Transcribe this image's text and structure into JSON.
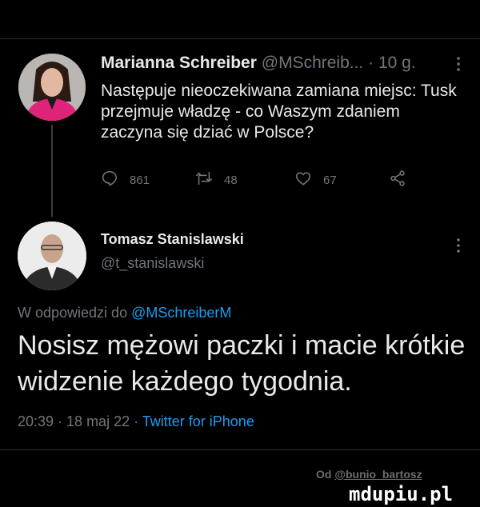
{
  "tweet1": {
    "name": "Marianna Schreiber",
    "handle": "@MSchreib...",
    "time": "· 10 g.",
    "text": "Następuje nieoczekiwana zamiana miejsc: Tusk przejmuje władzę - co Waszym zdaniem zaczyna się dziać w Polsce?",
    "replies": "861",
    "retweets": "48",
    "likes": "67"
  },
  "tweet2": {
    "name": "Tomasz Stanislawski",
    "handle": "@t_stanislawski",
    "reply_prefix": "W odpowiedzi do ",
    "reply_mention": "@MSchreiberM",
    "text": "Nosisz mężowi paczki i macie krótkie widzenie każdego tygodnia.",
    "timestamp": "20:39 · 18 maj 22 · ",
    "source": "Twitter for iPhone"
  },
  "footer": {
    "credit_prefix": "Od ",
    "credit_user": "@bunio_bartosz",
    "watermark": "mdupiu.pl"
  },
  "colors": {
    "background": "#000000",
    "text": "#e7e9ea",
    "secondary": "#71767b",
    "accent": "#1d9bf0"
  },
  "icons": [
    "reply-icon",
    "retweet-icon",
    "like-icon",
    "share-icon",
    "more-icon"
  ]
}
